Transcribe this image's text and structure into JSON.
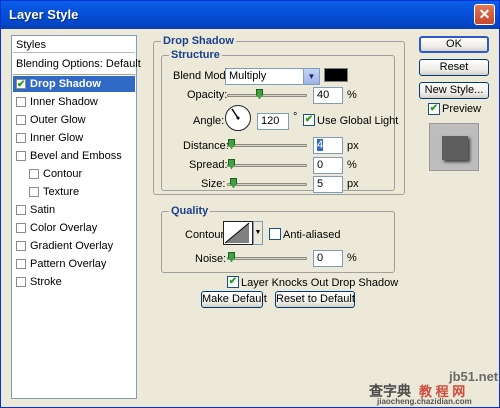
{
  "window": {
    "title": "Layer Style"
  },
  "sidebar": {
    "header": "Styles",
    "blending": "Blending Options: Default",
    "items": [
      {
        "label": "Drop Shadow",
        "checked": true,
        "selected": true
      },
      {
        "label": "Inner Shadow",
        "checked": false
      },
      {
        "label": "Outer Glow",
        "checked": false
      },
      {
        "label": "Inner Glow",
        "checked": false
      },
      {
        "label": "Bevel and Emboss",
        "checked": false
      },
      {
        "label": "Contour",
        "checked": false,
        "indent": true
      },
      {
        "label": "Texture",
        "checked": false,
        "indent": true
      },
      {
        "label": "Satin",
        "checked": false
      },
      {
        "label": "Color Overlay",
        "checked": false
      },
      {
        "label": "Gradient Overlay",
        "checked": false
      },
      {
        "label": "Pattern Overlay",
        "checked": false
      },
      {
        "label": "Stroke",
        "checked": false
      }
    ]
  },
  "drop_shadow": {
    "section_title": "Drop Shadow",
    "structure_title": "Structure",
    "blend_mode_label": "Blend Mode:",
    "blend_mode_value": "Multiply",
    "shadow_color": "#000000",
    "opacity_label": "Opacity:",
    "opacity_value": "40",
    "opacity_fraction": 0.4,
    "percent": "%",
    "angle_label": "Angle:",
    "angle_value": "120",
    "degree": "°",
    "use_global_light": "Use Global Light",
    "distance_label": "Distance:",
    "distance_value": "4",
    "spread_label": "Spread:",
    "spread_value": "0",
    "size_label": "Size:",
    "size_value": "5",
    "px": "px"
  },
  "quality": {
    "title": "Quality",
    "contour_label": "Contour:",
    "anti_aliased": "Anti-aliased",
    "noise_label": "Noise:",
    "noise_value": "0",
    "percent": "%",
    "knockout": "Layer Knocks Out Drop Shadow",
    "make_default": "Make Default",
    "reset_default": "Reset to Default"
  },
  "buttons": {
    "ok": "OK",
    "reset": "Reset",
    "new_style": "New Style...",
    "preview": "Preview"
  },
  "watermark": {
    "text1": "jb51.net",
    "text2": "查字典",
    "text3": "教 程 网",
    "text4": "jiaocheng.chazidian.com"
  }
}
